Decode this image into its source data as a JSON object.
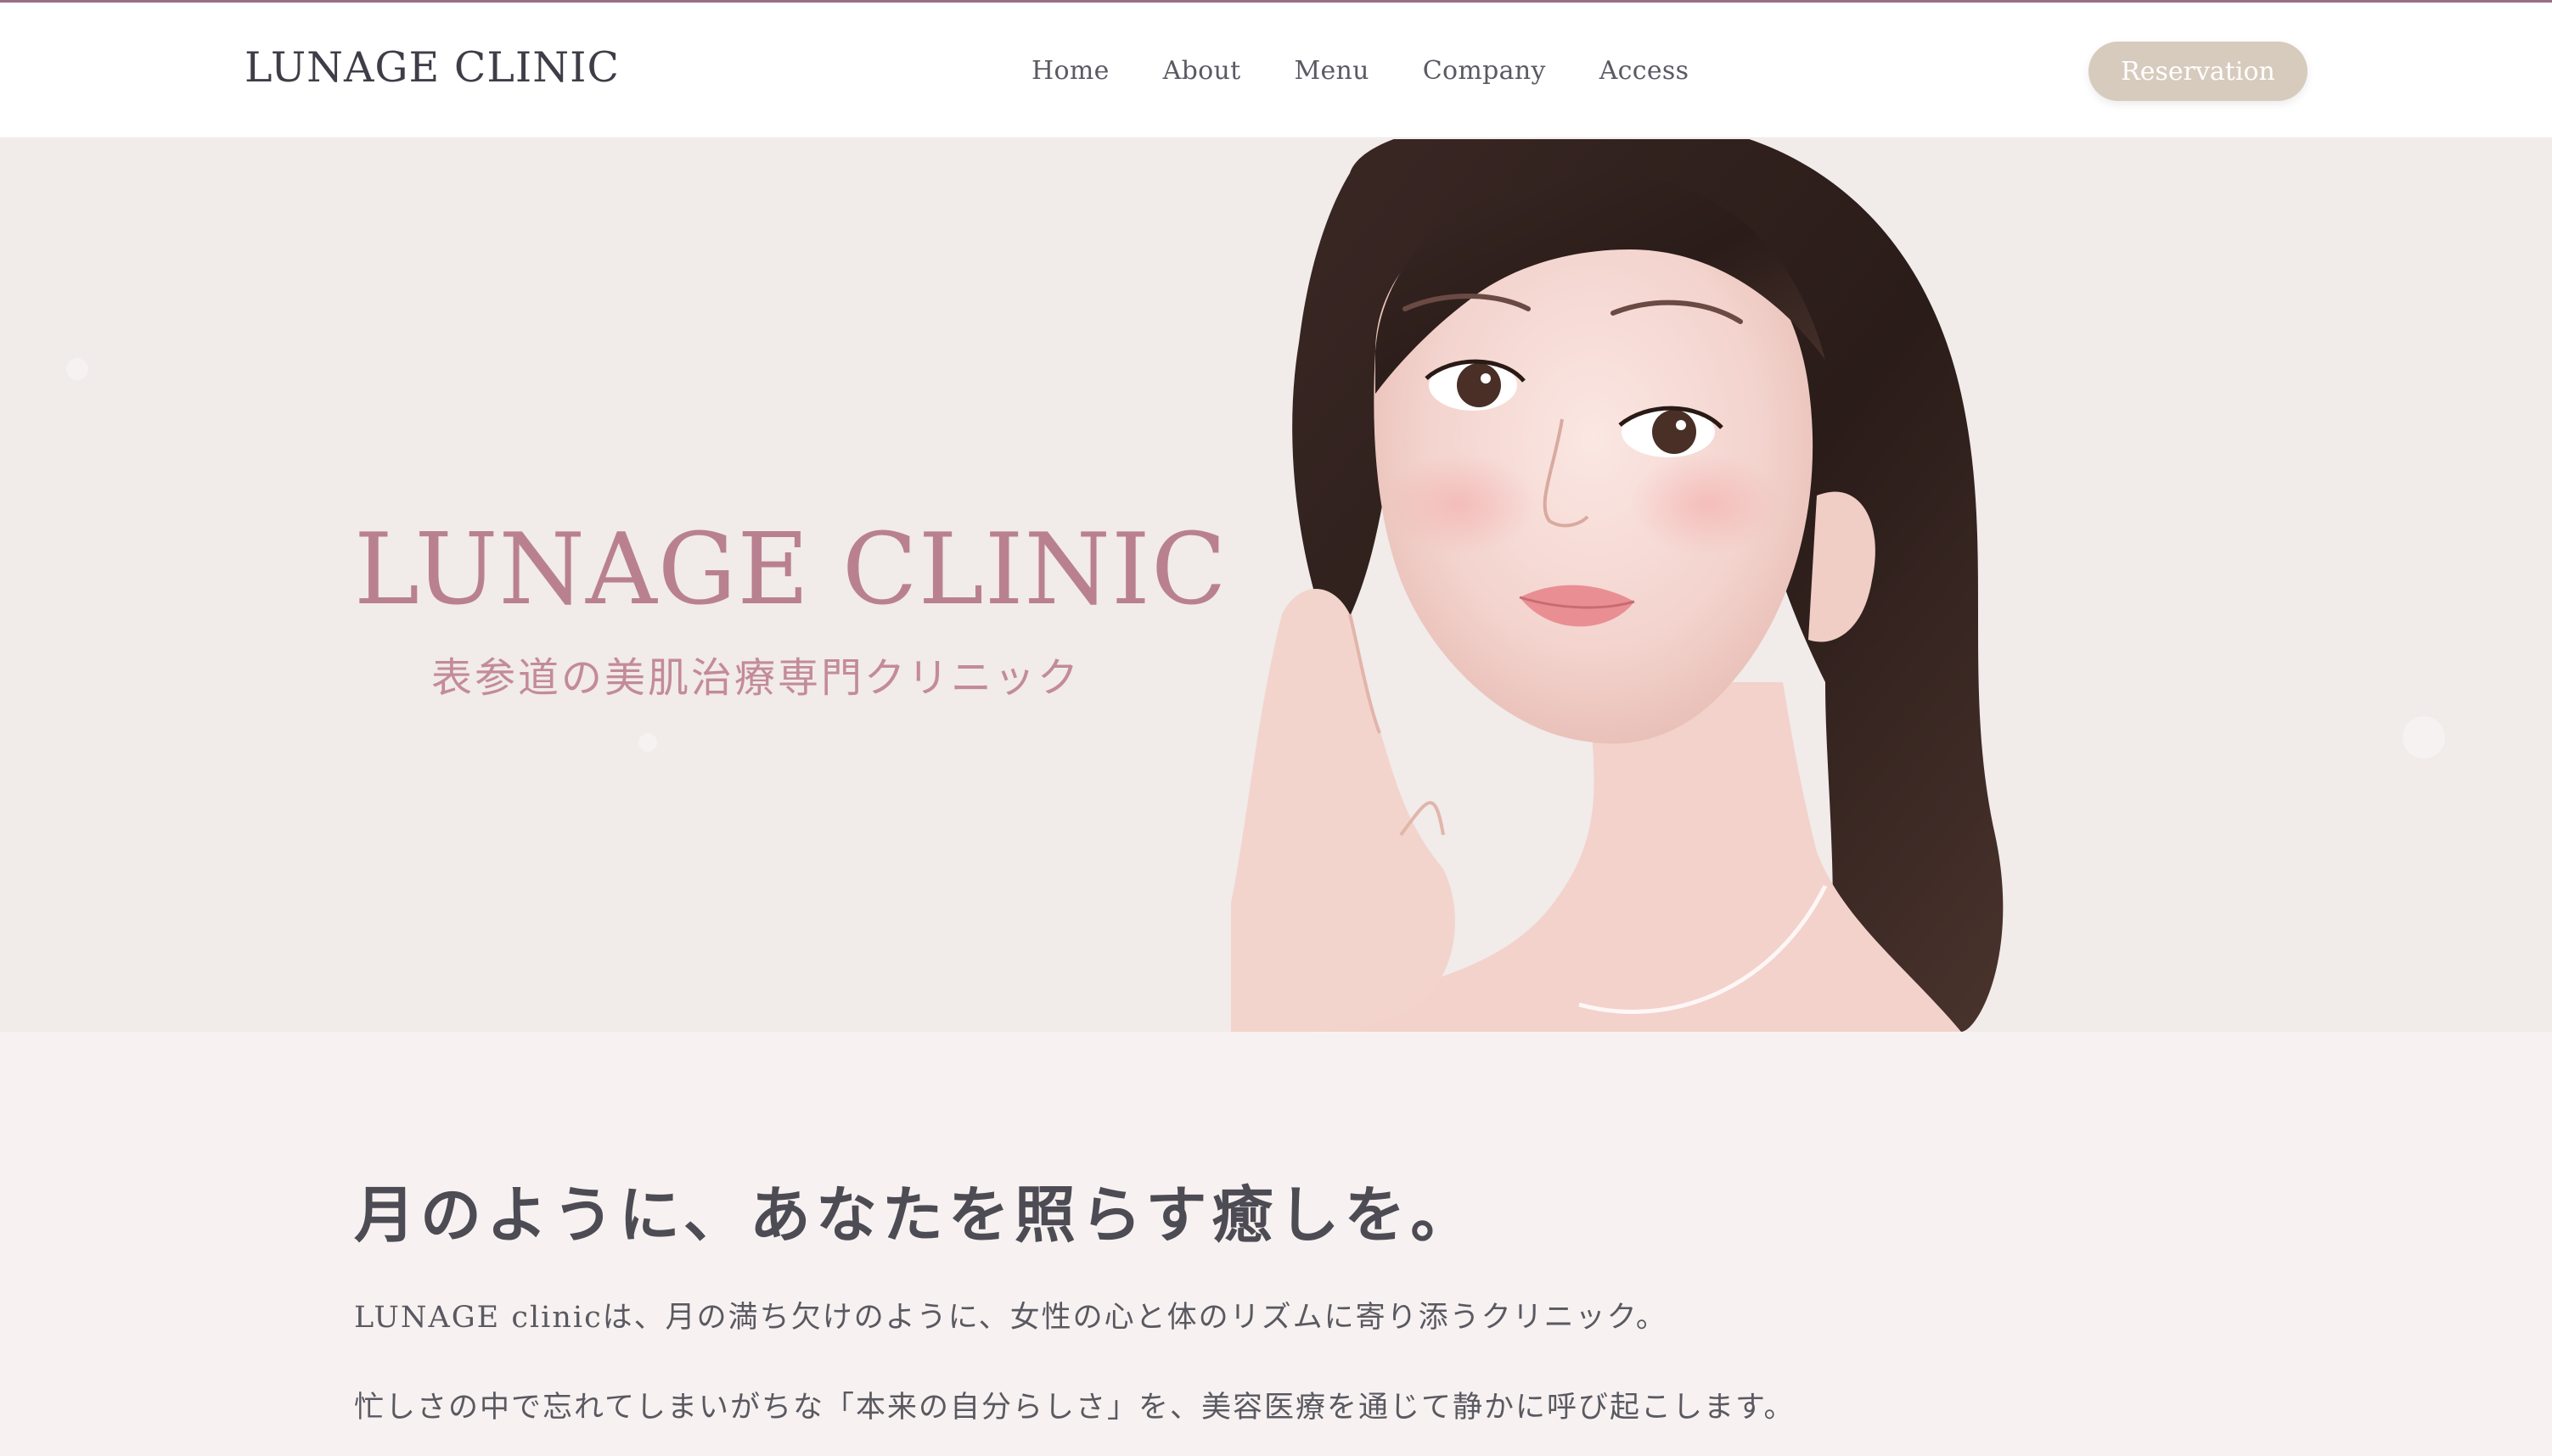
{
  "header": {
    "brand": "LUNAGE CLINIC",
    "nav": [
      {
        "label": "Home"
      },
      {
        "label": "About"
      },
      {
        "label": "Menu"
      },
      {
        "label": "Company"
      },
      {
        "label": "Access"
      }
    ],
    "reservation_label": "Reservation"
  },
  "hero": {
    "title": "LUNAGE CLINIC",
    "subtitle": "表参道の美肌治療専門クリニック",
    "image_icon": "woman-portrait-photo"
  },
  "intro": {
    "heading": "月のように、あなたを照らす癒しを。",
    "paragraph_1": "LUNAGE clinicは、月の満ち欠けのように、女性の心と体のリズムに寄り添うクリニック。",
    "paragraph_2": "忙しさの中で忘れてしまいがちな「本来の自分らしさ」を、美容医療を通じて静かに呼び起こします。"
  },
  "colors": {
    "accent_rose": "#b9818f",
    "button_beige": "#d7cbbd",
    "hero_bg": "#f1ebea",
    "page_bg": "#f7f2f1",
    "header_top_border": "#9a6f83"
  }
}
